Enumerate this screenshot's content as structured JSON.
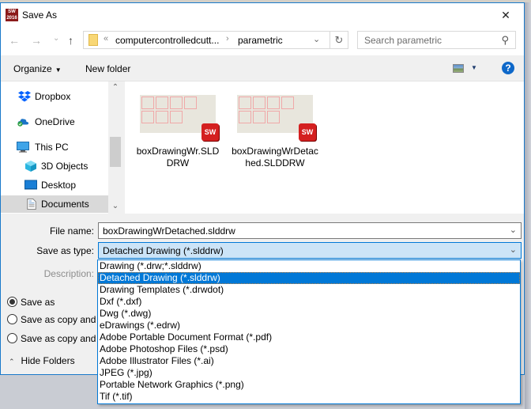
{
  "window": {
    "title": "Save As",
    "app_icon": "solidworks-2016-icon",
    "app_icon_text": "2016",
    "close_glyph": "✕"
  },
  "navigation": {
    "back_glyph": "←",
    "forward_glyph": "→",
    "recent_glyph": "⌄",
    "up_glyph": "↑",
    "breadcrumb": {
      "overflow_glyph": "«",
      "segments": [
        "computercontrolledcutt...",
        "parametric"
      ],
      "separator_glyph": "›",
      "dropdown_glyph": "⌄",
      "refresh_glyph": "↻"
    },
    "search": {
      "placeholder": "Search parametric",
      "icon_glyph": "⚲"
    }
  },
  "toolbar": {
    "organize_label": "Organize",
    "organize_caret": "▼",
    "new_folder_label": "New folder",
    "view_caret": "▼",
    "help_glyph": "?"
  },
  "nav_pane": {
    "items": [
      {
        "label": "Dropbox",
        "icon": "dropbox-icon",
        "selected": false
      },
      {
        "label": "OneDrive",
        "icon": "onedrive-icon",
        "selected": false
      },
      {
        "label": "This PC",
        "icon": "this-pc-icon",
        "selected": false
      },
      {
        "label": "3D Objects",
        "icon": "3d-objects-icon",
        "selected": false
      },
      {
        "label": "Desktop",
        "icon": "desktop-icon",
        "selected": false
      },
      {
        "label": "Documents",
        "icon": "documents-icon",
        "selected": true
      }
    ],
    "scroll_up_glyph": "⌃",
    "scroll_down_glyph": "⌄"
  },
  "files": [
    {
      "name": "boxDrawingWr.SLDDRW",
      "badge": "SW"
    },
    {
      "name": "boxDrawingWrDetached.SLDDRW",
      "badge": "SW"
    }
  ],
  "form": {
    "file_name_label": "File name:",
    "file_name_value": "boxDrawingWrDetached.slddrw",
    "save_as_type_label": "Save as type:",
    "save_as_type_value": "Detached Drawing (*.slddrw)",
    "description_label": "Description:",
    "combo_chevron": "⌄"
  },
  "type_options": [
    {
      "label": "Drawing (*.drw;*.slddrw)",
      "selected": false
    },
    {
      "label": "Detached Drawing (*.slddrw)",
      "selected": true
    },
    {
      "label": "Drawing Templates (*.drwdot)",
      "selected": false
    },
    {
      "label": "Dxf (*.dxf)",
      "selected": false
    },
    {
      "label": "Dwg (*.dwg)",
      "selected": false
    },
    {
      "label": "eDrawings (*.edrw)",
      "selected": false
    },
    {
      "label": "Adobe Portable Document Format (*.pdf)",
      "selected": false
    },
    {
      "label": "Adobe Photoshop Files (*.psd)",
      "selected": false
    },
    {
      "label": "Adobe Illustrator Files (*.ai)",
      "selected": false
    },
    {
      "label": "JPEG (*.jpg)",
      "selected": false
    },
    {
      "label": "Portable Network Graphics (*.png)",
      "selected": false
    },
    {
      "label": "Tif (*.tif)",
      "selected": false
    }
  ],
  "save_options": [
    {
      "label": "Save as",
      "checked": true
    },
    {
      "label": "Save as copy and continue",
      "checked": false
    },
    {
      "label": "Save as copy and open",
      "checked": false
    }
  ],
  "hide_folders": {
    "label": "Hide Folders",
    "glyph": "⌃"
  },
  "colors": {
    "accent": "#0078d7",
    "selected_field_bg": "#cce4f7",
    "help_blue": "#0e68c9",
    "sw_red": "#d42020"
  }
}
